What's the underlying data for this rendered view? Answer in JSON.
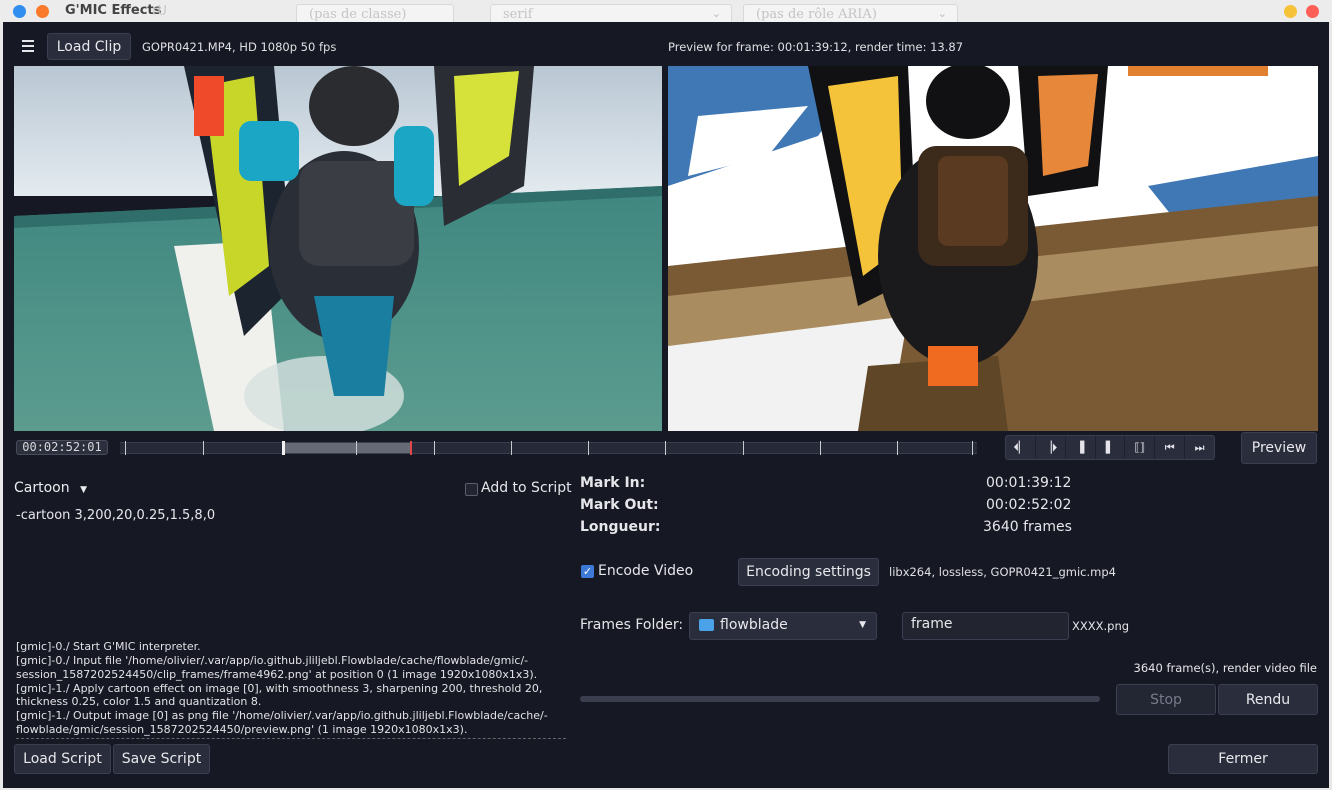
{
  "titlebar": {
    "title": "G'MIC Effects",
    "ghost_fields": [
      "(pas de classe)",
      "serif",
      "(pas de rôle ARIA)"
    ],
    "ghost_prefix": "rU"
  },
  "toolbar": {
    "load_clip_label": "Load Clip",
    "clip_info": "GOPR0421.MP4, HD 1080p 50 fps",
    "preview_info": "Preview for frame: 00:01:39:12, render time: 13.87"
  },
  "timeline": {
    "timecode": "00:02:52:01",
    "preview_label": "Preview",
    "transport": [
      "⏴▏",
      "▕⏵",
      "▐",
      "▌",
      "⟦⟧",
      "⏮",
      "⏭"
    ]
  },
  "filter": {
    "name": "Cartoon",
    "add_to_script_label": "Add to Script",
    "add_to_script_checked": false,
    "command": "-cartoon 3,200,20,0.25,1.5,8,0"
  },
  "log": {
    "lines": [
      "[gmic]-0./ Start G'MIC interpreter.",
      "[gmic]-0./ Input file '/home/olivier/.var/app/io.github.jliljebl.Flowblade/cache/flowblade/gmic/-session_1587202524450/clip_frames/frame4962.png' at position 0 (1 image 1920x1080x1x3).",
      "[gmic]-1./ Apply cartoon effect on image [0], with smoothness 3, sharpening 200, threshold 20, thickness 0.25, color 1.5 and quantization 8.",
      "[gmic]-1./ Output image [0] as png file '/home/olivier/.var/app/io.github.jliljebl.Flowblade/cache/-flowblade/gmic/session_1587202524450/preview.png' (1 image 1920x1080x1x3)."
    ]
  },
  "marks": {
    "mark_in_label": "Mark In:",
    "mark_in_value": "00:01:39:12",
    "mark_out_label": "Mark Out:",
    "mark_out_value": "00:02:52:02",
    "length_label": "Longueur:",
    "length_value": "3640 frames"
  },
  "encode": {
    "encode_video_label": "Encode Video",
    "encode_video_checked": true,
    "encoding_settings_label": "Encoding settings",
    "encoding_info": "libx264, lossless, GOPR0421_gmic.mp4"
  },
  "frames": {
    "folder_label": "Frames Folder:",
    "folder_value": "flowblade",
    "name_value": "frame",
    "suffix": "XXXX.png",
    "render_status": "3640 frame(s), render video file"
  },
  "render": {
    "progress": 0,
    "stop_label": "Stop",
    "render_label": "Rendu"
  },
  "bottom": {
    "load_script_label": "Load Script",
    "save_script_label": "Save Script",
    "close_label": "Fermer"
  },
  "colors": {
    "window_bg": "#161824",
    "accent": "#3d7ad6",
    "close_red": "#ff5f57",
    "close_orange": "#f97a2a"
  }
}
